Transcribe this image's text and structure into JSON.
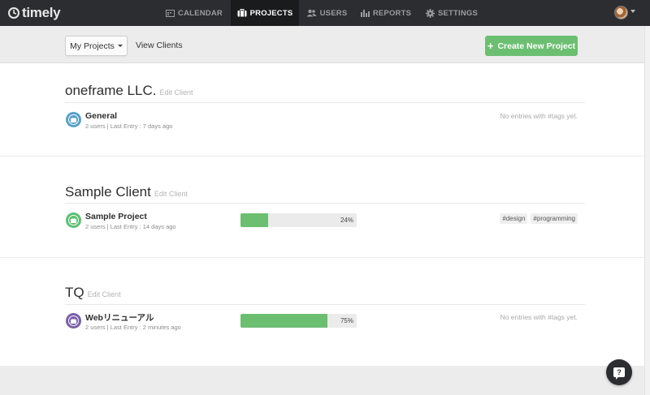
{
  "app": {
    "logo": "timely"
  },
  "nav": {
    "items": [
      {
        "label": "CALENDAR",
        "icon": "calendar-icon"
      },
      {
        "label": "PROJECTS",
        "icon": "briefcase-icon",
        "active": true
      },
      {
        "label": "USERS",
        "icon": "users-icon"
      },
      {
        "label": "REPORTS",
        "icon": "bar-chart-icon"
      },
      {
        "label": "SETTINGS",
        "icon": "gear-icon"
      }
    ]
  },
  "toolbar": {
    "filter_label": "My Projects",
    "view_clients": "View Clients",
    "create_label": "Create New Project"
  },
  "clients": [
    {
      "name": "oneframe LLC.",
      "edit_label": "Edit Client",
      "projects": [
        {
          "name": "General",
          "meta": "2 users | Last Entry : 7 days ago",
          "icon_color": "#5aa0c8",
          "no_tags": "No entries with #tags yet."
        }
      ]
    },
    {
      "name": "Sample Client",
      "edit_label": "Edit Client",
      "projects": [
        {
          "name": "Sample Project",
          "meta": "2 users | Last Entry : 14 days ago",
          "icon_color": "#5cbf72",
          "progress": 0.24,
          "progress_label": "24%",
          "tags": [
            "#design",
            "#programming"
          ]
        }
      ]
    },
    {
      "name": "TQ",
      "edit_label": "Edit Client",
      "projects": [
        {
          "name": "Webリニューアル",
          "meta": "2 users | Last Entry : 2 minutes ago",
          "icon_color": "#7a5ea8",
          "progress": 0.75,
          "progress_label": "75%",
          "no_tags": "No entries with #tags yet."
        }
      ]
    }
  ],
  "colors": {
    "accent": "#6cbf71",
    "nav_bg": "#2c2d30"
  }
}
